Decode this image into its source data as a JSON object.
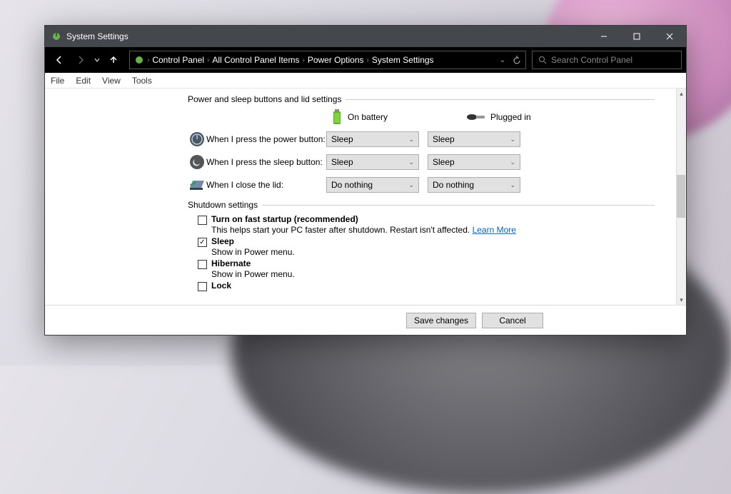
{
  "titlebar": {
    "title": "System Settings"
  },
  "breadcrumbs": [
    "Control Panel",
    "All Control Panel Items",
    "Power Options",
    "System Settings"
  ],
  "search": {
    "placeholder": "Search Control Panel"
  },
  "menu": [
    "File",
    "Edit",
    "View",
    "Tools"
  ],
  "groups": {
    "buttons_lid": {
      "title": "Power and sleep buttons and lid settings",
      "columns": {
        "battery": "On battery",
        "plugged": "Plugged in"
      },
      "rows": [
        {
          "label": "When I press the power button:",
          "battery": "Sleep",
          "plugged": "Sleep"
        },
        {
          "label": "When I press the sleep button:",
          "battery": "Sleep",
          "plugged": "Sleep"
        },
        {
          "label": "When I close the lid:",
          "battery": "Do nothing",
          "plugged": "Do nothing"
        }
      ]
    },
    "shutdown": {
      "title": "Shutdown settings",
      "items": [
        {
          "label": "Turn on fast startup (recommended)",
          "checked": false,
          "desc": "This helps start your PC faster after shutdown. Restart isn't affected.",
          "link": "Learn More"
        },
        {
          "label": "Sleep",
          "checked": true,
          "desc": "Show in Power menu."
        },
        {
          "label": "Hibernate",
          "checked": false,
          "desc": "Show in Power menu."
        },
        {
          "label": "Lock",
          "checked": false
        }
      ]
    }
  },
  "footer": {
    "save": "Save changes",
    "cancel": "Cancel"
  }
}
